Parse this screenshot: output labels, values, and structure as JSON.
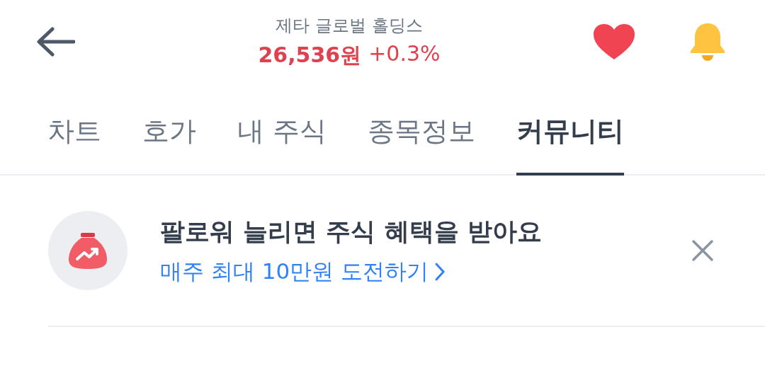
{
  "header": {
    "title": "제타 글로벌 홀딩스",
    "price": "26,536원",
    "change": "+0.3%",
    "favorite": true
  },
  "tabs": [
    {
      "label": "차트",
      "selected": false
    },
    {
      "label": "호가",
      "selected": false
    },
    {
      "label": "내 주식",
      "selected": false
    },
    {
      "label": "종목정보",
      "selected": false
    },
    {
      "label": "커뮤니티",
      "selected": true
    }
  ],
  "banner": {
    "title": "팔로워 늘리면 주식 혜택을 받아요",
    "link": "매주 최대 10만원 도전하기"
  }
}
